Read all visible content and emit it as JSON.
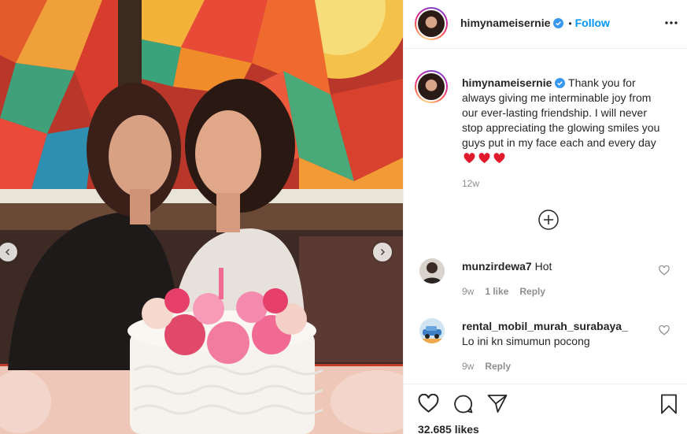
{
  "post": {
    "username": "himynameisernie",
    "follow_label": "Follow",
    "separator": "•",
    "caption": "Thank you for always giving me interminable joy from our ever-lasting friendship. I will never stop appreciating the glowing smiles you guys put in my face each and every day",
    "caption_emoji": [
      "red-heart",
      "red-heart",
      "red-heart"
    ],
    "age": "12w",
    "likes": "32.685 likes"
  },
  "comments": [
    {
      "username": "munzirdewa7",
      "text": "Hot",
      "age": "9w",
      "likes": "1 like",
      "reply": "Reply"
    },
    {
      "username": "rental_mobil_murah_surabaya_",
      "text": "Lo ini kn simumun pocong",
      "age": "9w",
      "reply": "Reply"
    }
  ],
  "icons": {
    "verified": "verified-badge-icon",
    "more": "more-options-icon",
    "load_more": "add-circle-icon",
    "like": "heart-icon",
    "comment": "comment-icon",
    "share": "share-icon",
    "save": "bookmark-icon"
  },
  "colors": {
    "accent": "#0095f6",
    "text": "#262626",
    "muted": "#8e8e8e",
    "heart": "#ed4956"
  }
}
